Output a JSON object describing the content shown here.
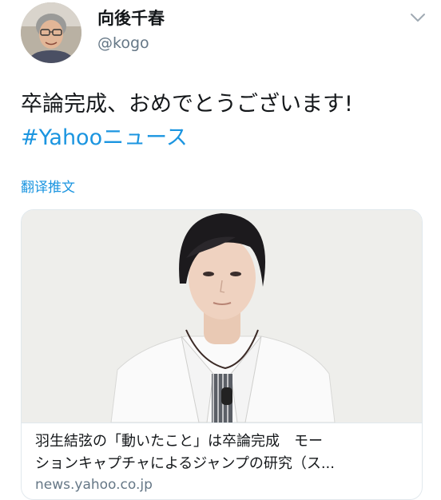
{
  "author": {
    "display_name": "向後千春",
    "handle": "@kogo"
  },
  "tweet": {
    "text_line1": "卒論完成、おめでとうございます!",
    "hashtag": "#Yahooニュース",
    "translate_label": "翻译推文"
  },
  "card": {
    "title_line1": "羽生結弦の「動いたこと」は卒論完成　モー",
    "title_line2": "ションキャプチャによるジャンプの研究（ス...",
    "domain": "news.yahoo.co.jp"
  },
  "icons": {
    "menu": "chevron-down-icon"
  },
  "colors": {
    "link": "#1b95e0",
    "secondary_text": "#657786",
    "border": "#e1e8ed"
  }
}
